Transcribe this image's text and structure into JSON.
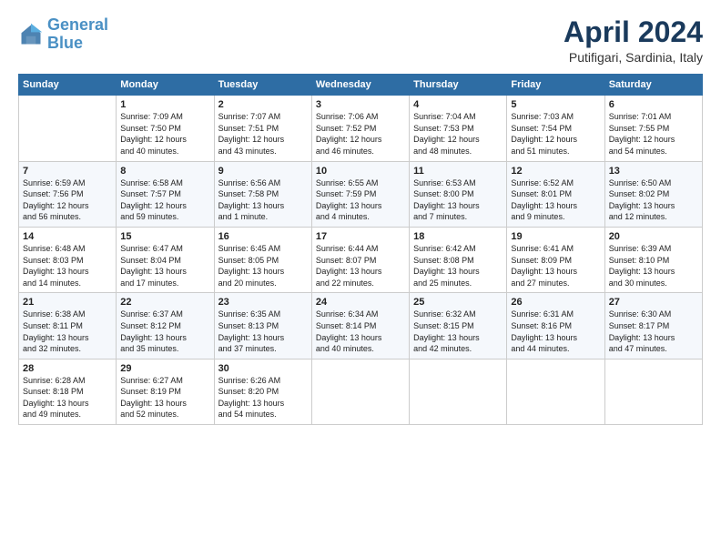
{
  "logo": {
    "line1": "General",
    "line2": "Blue"
  },
  "title": "April 2024",
  "location": "Putifigari, Sardinia, Italy",
  "headers": [
    "Sunday",
    "Monday",
    "Tuesday",
    "Wednesday",
    "Thursday",
    "Friday",
    "Saturday"
  ],
  "weeks": [
    [
      {
        "num": "",
        "info": ""
      },
      {
        "num": "1",
        "info": "Sunrise: 7:09 AM\nSunset: 7:50 PM\nDaylight: 12 hours\nand 40 minutes."
      },
      {
        "num": "2",
        "info": "Sunrise: 7:07 AM\nSunset: 7:51 PM\nDaylight: 12 hours\nand 43 minutes."
      },
      {
        "num": "3",
        "info": "Sunrise: 7:06 AM\nSunset: 7:52 PM\nDaylight: 12 hours\nand 46 minutes."
      },
      {
        "num": "4",
        "info": "Sunrise: 7:04 AM\nSunset: 7:53 PM\nDaylight: 12 hours\nand 48 minutes."
      },
      {
        "num": "5",
        "info": "Sunrise: 7:03 AM\nSunset: 7:54 PM\nDaylight: 12 hours\nand 51 minutes."
      },
      {
        "num": "6",
        "info": "Sunrise: 7:01 AM\nSunset: 7:55 PM\nDaylight: 12 hours\nand 54 minutes."
      }
    ],
    [
      {
        "num": "7",
        "info": "Sunrise: 6:59 AM\nSunset: 7:56 PM\nDaylight: 12 hours\nand 56 minutes."
      },
      {
        "num": "8",
        "info": "Sunrise: 6:58 AM\nSunset: 7:57 PM\nDaylight: 12 hours\nand 59 minutes."
      },
      {
        "num": "9",
        "info": "Sunrise: 6:56 AM\nSunset: 7:58 PM\nDaylight: 13 hours\nand 1 minute."
      },
      {
        "num": "10",
        "info": "Sunrise: 6:55 AM\nSunset: 7:59 PM\nDaylight: 13 hours\nand 4 minutes."
      },
      {
        "num": "11",
        "info": "Sunrise: 6:53 AM\nSunset: 8:00 PM\nDaylight: 13 hours\nand 7 minutes."
      },
      {
        "num": "12",
        "info": "Sunrise: 6:52 AM\nSunset: 8:01 PM\nDaylight: 13 hours\nand 9 minutes."
      },
      {
        "num": "13",
        "info": "Sunrise: 6:50 AM\nSunset: 8:02 PM\nDaylight: 13 hours\nand 12 minutes."
      }
    ],
    [
      {
        "num": "14",
        "info": "Sunrise: 6:48 AM\nSunset: 8:03 PM\nDaylight: 13 hours\nand 14 minutes."
      },
      {
        "num": "15",
        "info": "Sunrise: 6:47 AM\nSunset: 8:04 PM\nDaylight: 13 hours\nand 17 minutes."
      },
      {
        "num": "16",
        "info": "Sunrise: 6:45 AM\nSunset: 8:05 PM\nDaylight: 13 hours\nand 20 minutes."
      },
      {
        "num": "17",
        "info": "Sunrise: 6:44 AM\nSunset: 8:07 PM\nDaylight: 13 hours\nand 22 minutes."
      },
      {
        "num": "18",
        "info": "Sunrise: 6:42 AM\nSunset: 8:08 PM\nDaylight: 13 hours\nand 25 minutes."
      },
      {
        "num": "19",
        "info": "Sunrise: 6:41 AM\nSunset: 8:09 PM\nDaylight: 13 hours\nand 27 minutes."
      },
      {
        "num": "20",
        "info": "Sunrise: 6:39 AM\nSunset: 8:10 PM\nDaylight: 13 hours\nand 30 minutes."
      }
    ],
    [
      {
        "num": "21",
        "info": "Sunrise: 6:38 AM\nSunset: 8:11 PM\nDaylight: 13 hours\nand 32 minutes."
      },
      {
        "num": "22",
        "info": "Sunrise: 6:37 AM\nSunset: 8:12 PM\nDaylight: 13 hours\nand 35 minutes."
      },
      {
        "num": "23",
        "info": "Sunrise: 6:35 AM\nSunset: 8:13 PM\nDaylight: 13 hours\nand 37 minutes."
      },
      {
        "num": "24",
        "info": "Sunrise: 6:34 AM\nSunset: 8:14 PM\nDaylight: 13 hours\nand 40 minutes."
      },
      {
        "num": "25",
        "info": "Sunrise: 6:32 AM\nSunset: 8:15 PM\nDaylight: 13 hours\nand 42 minutes."
      },
      {
        "num": "26",
        "info": "Sunrise: 6:31 AM\nSunset: 8:16 PM\nDaylight: 13 hours\nand 44 minutes."
      },
      {
        "num": "27",
        "info": "Sunrise: 6:30 AM\nSunset: 8:17 PM\nDaylight: 13 hours\nand 47 minutes."
      }
    ],
    [
      {
        "num": "28",
        "info": "Sunrise: 6:28 AM\nSunset: 8:18 PM\nDaylight: 13 hours\nand 49 minutes."
      },
      {
        "num": "29",
        "info": "Sunrise: 6:27 AM\nSunset: 8:19 PM\nDaylight: 13 hours\nand 52 minutes."
      },
      {
        "num": "30",
        "info": "Sunrise: 6:26 AM\nSunset: 8:20 PM\nDaylight: 13 hours\nand 54 minutes."
      },
      {
        "num": "",
        "info": ""
      },
      {
        "num": "",
        "info": ""
      },
      {
        "num": "",
        "info": ""
      },
      {
        "num": "",
        "info": ""
      }
    ]
  ]
}
